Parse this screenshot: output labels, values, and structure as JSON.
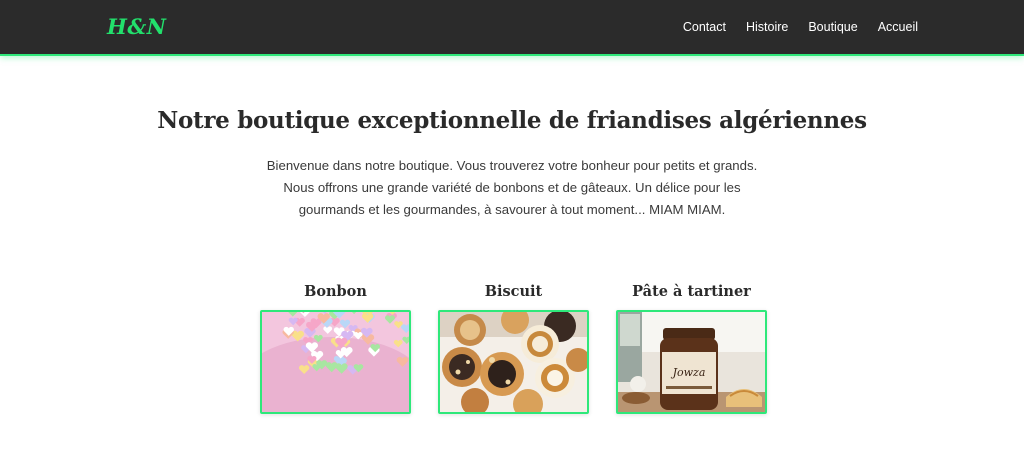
{
  "header": {
    "logo": "H&N",
    "nav": [
      "Contact",
      "Histoire",
      "Boutique",
      "Accueil"
    ]
  },
  "hero": {
    "title": "Notre boutique exceptionnelle de friandises algériennes",
    "lines": [
      "Bienvenue dans notre boutique. Vous trouverez votre bonheur pour petits et grands.",
      "Nous offrons une grande variété de bonbons et de gâteaux. Un délice pour les",
      "gourmands et les gourmandes, à savourer à tout moment... MIAM MIAM."
    ]
  },
  "products": [
    {
      "title": "Bonbon"
    },
    {
      "title": "Biscuit"
    },
    {
      "title": "Pâte à tartiner",
      "jar_label": "Jowza"
    }
  ],
  "colors": {
    "accent": "#2ee87a",
    "header_bg": "#2b2b2b"
  }
}
